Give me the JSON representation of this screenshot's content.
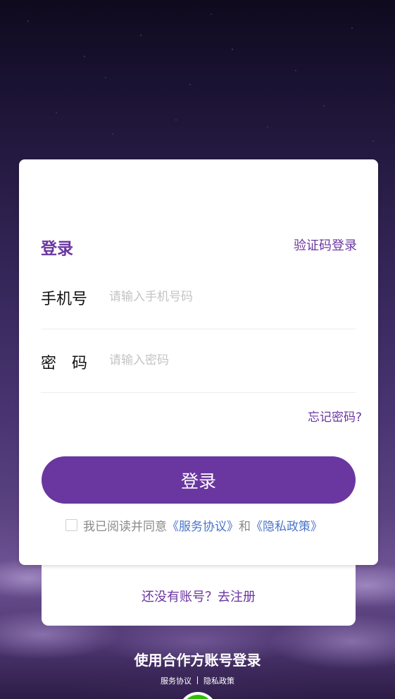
{
  "login": {
    "title": "登录",
    "code_login": "验证码登录",
    "phone_label": "手机号",
    "phone_placeholder": "请输入手机号码",
    "password_label": "密　码",
    "password_placeholder": "请输入密码",
    "forgot_password": "忘记密码?",
    "submit": "登录"
  },
  "agreement": {
    "prefix": "我已阅读并同意",
    "service": "《服务协议》",
    "and": "和",
    "privacy": "《隐私政策》"
  },
  "register": {
    "text": "还没有账号？去注册"
  },
  "partner": {
    "title": "使用合作方账号登录",
    "service_link": "服务协议",
    "privacy_link": "隐私政策",
    "icons": [
      "wechat-icon"
    ]
  },
  "colors": {
    "brand": "#6a36a0",
    "link_blue": "#4a74c9",
    "wechat_green": "#2dc100"
  }
}
